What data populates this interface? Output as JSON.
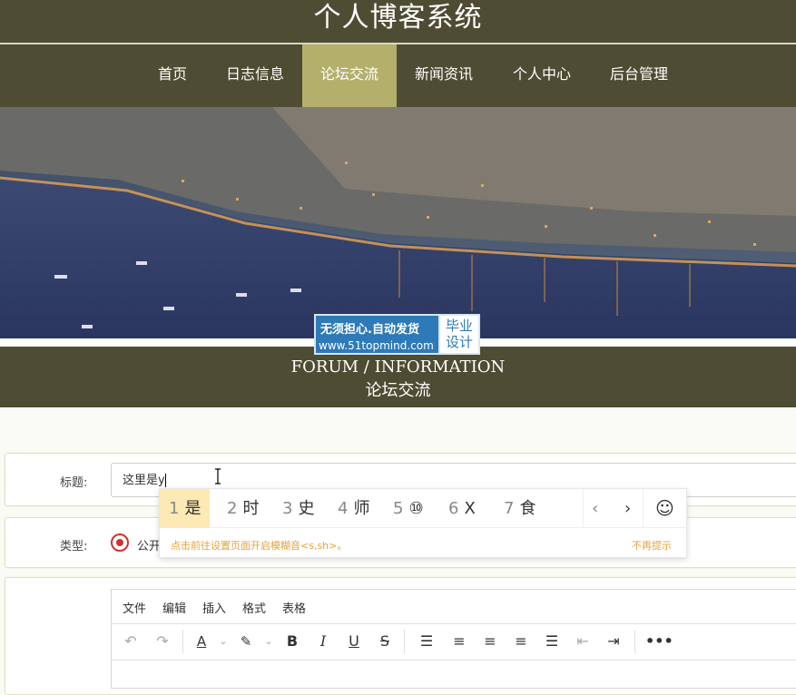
{
  "header": {
    "site_title": "个人博客系统"
  },
  "nav": {
    "items": [
      {
        "label": "首页"
      },
      {
        "label": "日志信息"
      },
      {
        "label": "论坛交流"
      },
      {
        "label": "新闻资讯"
      },
      {
        "label": "个人中心"
      },
      {
        "label": "后台管理"
      }
    ],
    "active_index": 2
  },
  "watermark": {
    "line1": "无须担心.自动发货",
    "line2": "www.51topmind.com",
    "right_top": "毕业",
    "right_bottom": "设计"
  },
  "section": {
    "title_en": "FORUM / INFORMATION",
    "title_cn": "论坛交流"
  },
  "form": {
    "title_label": "标题:",
    "title_value": "这里是y",
    "type_label": "类型:",
    "type_option": "公开"
  },
  "editor": {
    "menu": [
      "文件",
      "编辑",
      "插入",
      "格式",
      "表格"
    ],
    "toolbar": [
      "undo-icon",
      "redo-icon",
      "font-color-icon",
      "highlight-color-icon",
      "bold-icon",
      "italic-icon",
      "underline-icon",
      "strikethrough-icon",
      "line-height-icon",
      "align-left-icon",
      "align-center-icon",
      "align-right-icon",
      "align-justify-icon",
      "outdent-icon",
      "indent-icon",
      "more-icon"
    ]
  },
  "ime": {
    "candidates": [
      {
        "num": "1",
        "text": "是"
      },
      {
        "num": "2",
        "text": "时"
      },
      {
        "num": "3",
        "text": "史"
      },
      {
        "num": "4",
        "text": "师"
      },
      {
        "num": "5",
        "text": "⑩"
      },
      {
        "num": "6",
        "text": "X"
      },
      {
        "num": "7",
        "text": "食"
      }
    ],
    "prev": "‹",
    "next": "›",
    "emoji": "☺",
    "hint": "点击前往设置页面开启模糊音<s,sh>。",
    "dismiss": "不再提示"
  },
  "colors": {
    "header_bg": "#4e4d33",
    "nav_active": "#b4af6b",
    "radio": "#d32f2f",
    "ime_highlight": "#fde9b3",
    "ime_hint": "#e6a23c"
  }
}
